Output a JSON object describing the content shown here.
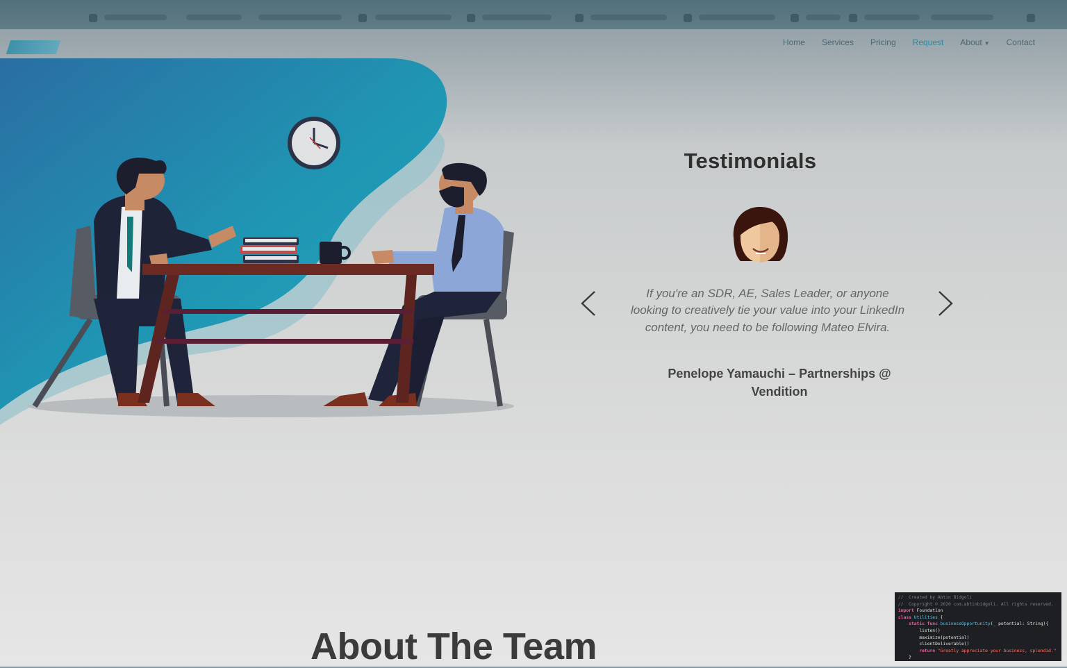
{
  "nav": {
    "items": [
      {
        "label": "Home"
      },
      {
        "label": "Services"
      },
      {
        "label": "Pricing"
      },
      {
        "label": "Request"
      },
      {
        "label": "About"
      },
      {
        "label": "Contact"
      }
    ],
    "active": "Request"
  },
  "testimonials": {
    "title": "Testimonials",
    "quote": "If you're an SDR, AE, Sales Leader, or anyone looking to creatively tie your value into your LinkedIn content, you need to be following Mateo Elvira.",
    "author": "Penelope Yamauchi – Partnerships @ Vendition"
  },
  "about": {
    "title": "About The Team"
  },
  "code_snippet": {
    "line1": "//  Created by Abtin Bidgoli",
    "line2": "//  Copyright © 2020 com.abtinbidgoli. All rights reserved.",
    "line3_kw": "import",
    "line3_rest": " Foundation",
    "line4_kw": "class",
    "line4_type": " Utilities",
    "line4_rest": " {",
    "line5_kw": "static func",
    "line5_fn": " businessOpportunity",
    "line5_rest": "(_ potential: String){",
    "line6": "listen()",
    "line7": "maximize(potential)",
    "line8": "clientDeliverable()",
    "line9_kw": "return",
    "line9_str": " \"Greatly appreciate your business, splendid.\"",
    "line10": "}"
  },
  "colors": {
    "accent": "#2b8aa0",
    "heading": "#2f2f2f",
    "quote_text": "#666666",
    "code_bg": "#1e1f23"
  }
}
